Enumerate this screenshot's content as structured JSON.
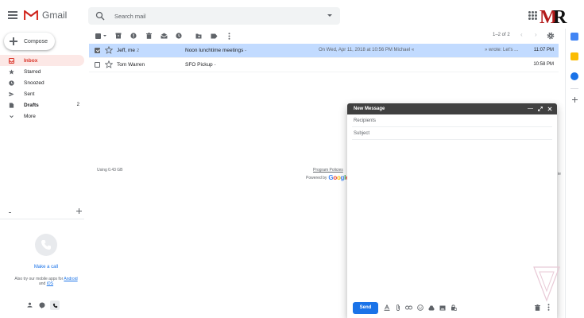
{
  "header": {
    "app_name": "Gmail",
    "search_placeholder": "Search mail",
    "brand_mark": "MR"
  },
  "compose_button": {
    "label": "Compose"
  },
  "nav": {
    "items": [
      {
        "label": "Inbox",
        "icon": "inbox-icon",
        "active": true
      },
      {
        "label": "Starred",
        "icon": "star-icon"
      },
      {
        "label": "Snoozed",
        "icon": "clock-icon"
      },
      {
        "label": "Sent",
        "icon": "send-icon"
      },
      {
        "label": "Drafts",
        "icon": "draft-icon",
        "count": "2"
      },
      {
        "label": "More",
        "icon": "chevron-down-icon"
      }
    ]
  },
  "hangouts": {
    "make_call": "Make a call",
    "try_apps_prefix": "Also try our mobile apps for",
    "android": "Android",
    "and": "and",
    "ios": "iOS"
  },
  "pager": {
    "range": "1–2 of 2"
  },
  "emails": [
    {
      "sender": "Jeff, me",
      "count": "2",
      "subject": "Noon lunchtime meetings",
      "separator": "-",
      "snippet_a": "On Wed, Apr 11, 2018 at 10:56 PM Michael «",
      "snippet_b": "» wrote: Let's ...",
      "time": "11:07 PM",
      "selected": true
    },
    {
      "sender": "Tom Warren",
      "count": "",
      "subject": "SFO Pickup",
      "separator": "-",
      "snippet_a": "",
      "snippet_b": "",
      "time": "10:58 PM",
      "selected": false
    }
  ],
  "footer": {
    "storage": "Using 0.43 GB",
    "program_policies": "Program Policies",
    "powered_by": "Powered by",
    "google": "Google",
    "side_glimpse": "ie"
  },
  "compose_window": {
    "title": "New Message",
    "recipients_placeholder": "Recipients",
    "subject_placeholder": "Subject",
    "send_label": "Send"
  },
  "colors": {
    "accent_blue": "#1a73e8",
    "gmail_red": "#d93025",
    "selected_row": "#c2dbff",
    "active_nav": "#fce8e6"
  }
}
